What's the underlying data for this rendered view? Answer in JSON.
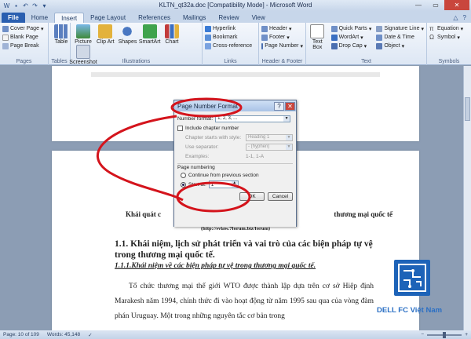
{
  "window": {
    "title": "KLTN_qt32a.doc [Compatibility Mode] - Microsoft Word"
  },
  "ribbon_tabs": [
    "File",
    "Home",
    "Insert",
    "Page Layout",
    "References",
    "Mailings",
    "Review",
    "View"
  ],
  "active_tab": "Insert",
  "ribbon": {
    "pages": {
      "items": [
        "Cover Page",
        "Blank Page",
        "Page Break"
      ],
      "label": "Pages"
    },
    "tables": {
      "item": "Table",
      "label": "Tables"
    },
    "illustrations": {
      "items": [
        "Picture",
        "Clip Art",
        "Shapes",
        "SmartArt",
        "Chart",
        "Screenshot"
      ],
      "label": "Illustrations"
    },
    "links": {
      "items": [
        "Hyperlink",
        "Bookmark",
        "Cross-reference"
      ],
      "label": "Links"
    },
    "header_footer": {
      "items": [
        "Header",
        "Footer",
        "Page Number"
      ],
      "label": "Header & Footer"
    },
    "text": {
      "textbox": "Text Box",
      "items": [
        "Quick Parts",
        "WordArt",
        "Drop Cap"
      ],
      "items2": [
        "Signature Line",
        "Date & Time",
        "Object"
      ],
      "label": "Text"
    },
    "symbols": {
      "items": [
        "Equation",
        "Symbol"
      ],
      "label": "Symbols"
    }
  },
  "dialog": {
    "title": "Page Number Format",
    "number_format_label": "Number format:",
    "number_format_value": "1, 2, 3, ...",
    "include_chapter": "Include chapter number",
    "chapter_style_label": "Chapter starts with style:",
    "chapter_style_value": "Heading 1",
    "separator_label": "Use separator:",
    "separator_value": "- (hyphen)",
    "examples_label": "Examples:",
    "examples_value": "1-1, 1-A",
    "page_numbering_label": "Page numbering",
    "continue_label": "Continue from previous section",
    "start_at_label": "Start at:",
    "start_at_value": "1",
    "ok": "OK",
    "cancel": "Cancel"
  },
  "document": {
    "heading_left": "Khái quát c",
    "heading_right": "thương mại quốc tế",
    "url": "(http://svlaw.7forum.biz/forum)",
    "h1": "1.1. Khái niệm, lịch sử phát triển và vai trò của các biện pháp tự vệ trong thương mại quốc tế.",
    "h2": "1.1.1.Khái niệm về các biện pháp tự vệ trong thương mại quốc tế.",
    "paragraph": "Tổ chức thương mại thế giới WTO được thành lập dựa trên cơ sở Hiệp định Marakesh năm 1994, chính thức đi vào hoạt động từ năm 1995 sau qua của vòng đàm phán Uruguay. Một trong những nguyên tắc cơ bản trong"
  },
  "status": {
    "page": "Page: 10 of 109",
    "words": "Words: 45,148"
  },
  "watermark": "DELL FC Việt Nam",
  "zoom": {
    "level_fraction": 0.5
  },
  "colors": {
    "annotation": "#d4141c",
    "file_tab": "#2a5fb0"
  }
}
